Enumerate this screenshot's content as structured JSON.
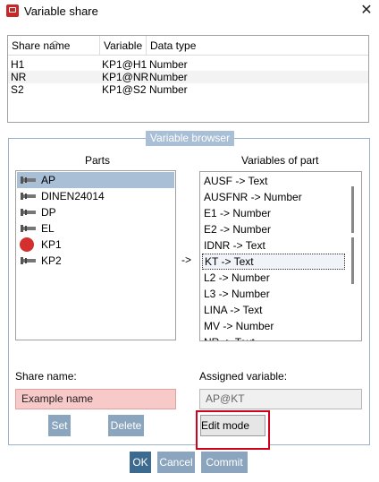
{
  "window": {
    "title": "Variable share"
  },
  "share_table": {
    "columns": [
      "Share name",
      "Variable",
      "Data type"
    ],
    "rows": [
      {
        "share_name": "H1",
        "variable": "KP1@H1",
        "data_type": "Number"
      },
      {
        "share_name": "NR",
        "variable": "KP1@NR",
        "data_type": "Number"
      },
      {
        "share_name": "S2",
        "variable": "KP1@S2",
        "data_type": "Number"
      }
    ]
  },
  "variable_browser": {
    "legend": "Variable browser",
    "parts_title": "Parts",
    "variables_title": "Variables of part",
    "parts": [
      "AP",
      "DINEN24014",
      "DP",
      "EL",
      "KP1",
      "KP2"
    ],
    "selected_part": "AP",
    "variables": [
      "AUSF -> Text",
      "AUSFNR -> Number",
      "E1 -> Number",
      "E2 -> Number",
      "IDNR -> Text",
      "KT -> Text",
      "L2 -> Number",
      "L3 -> Number",
      "LINA -> Text",
      "MV -> Number",
      "NR -> Text"
    ],
    "focused_variable": "KT -> Text",
    "arrow": "->"
  },
  "share_name": {
    "label": "Share name:",
    "value": "Example name"
  },
  "assigned_variable": {
    "label": "Assigned variable:",
    "value": "AP@KT"
  },
  "buttons": {
    "set": "Set",
    "delete": "Delete",
    "edit_mode": "Edit mode",
    "ok": "OK",
    "cancel": "Cancel",
    "commit": "Commit"
  },
  "colors": {
    "accent": "#a8bfd6",
    "button": "#8aa5bd",
    "ok_button": "#3d6b8f",
    "error_field": "#f8c9c9",
    "highlight_border": "#d0021b"
  }
}
